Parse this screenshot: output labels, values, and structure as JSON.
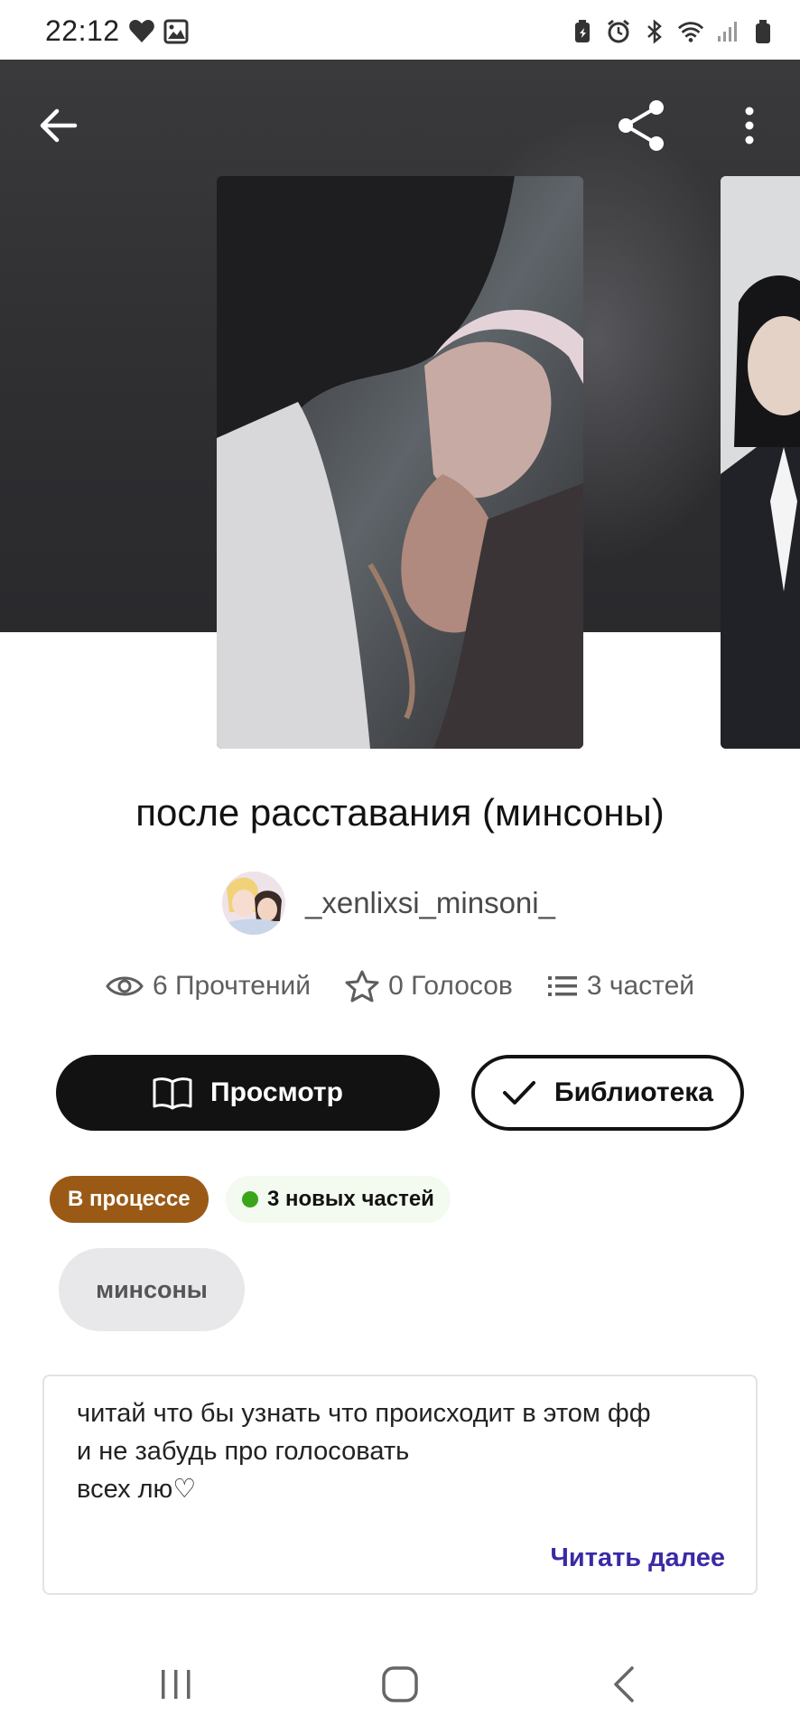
{
  "status_bar": {
    "time": "22:12",
    "left_icons": [
      "heart-icon",
      "image-icon"
    ],
    "right_icons": [
      "battery-saver-icon",
      "alarm-icon",
      "bluetooth-icon",
      "wifi-icon",
      "signal-icon",
      "battery-icon"
    ]
  },
  "toolbar": {
    "back_icon": "arrow-left-icon",
    "share_icon": "share-icon",
    "more_icon": "more-vertical-icon"
  },
  "story": {
    "title": "после расставания (минсоны)",
    "author": "_xenlixsi_minsoni_",
    "stats": {
      "reads": "6 Прочтений",
      "votes": "0 Голосов",
      "parts": "3 частей"
    }
  },
  "actions": {
    "view_label": "Просмотр",
    "library_label": "Библиотека"
  },
  "badges": {
    "status": "В процессе",
    "new_parts": "3 новых частей"
  },
  "tags": [
    "минсоны"
  ],
  "description": {
    "text": "читай что бы узнать что происходит в этом фф\nи не забудь про голосовать\nвсех лю♡",
    "read_more": "Читать далее"
  },
  "colors": {
    "status_badge": "#9a5a16",
    "new_dot": "#3aa51a",
    "read_more": "#3b2aa6",
    "primary_button": "#121212"
  }
}
